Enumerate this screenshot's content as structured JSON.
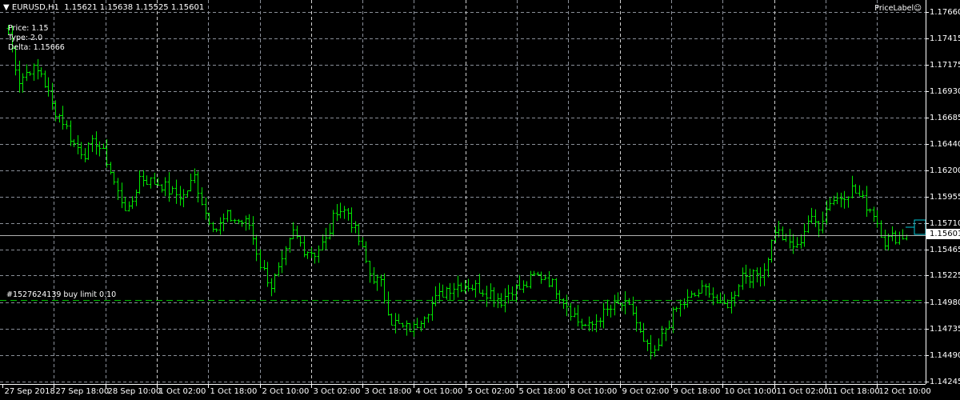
{
  "header": {
    "symbol": "EURUSD,H1",
    "ohlc": "1.15621 1.15638 1.15525 1.15601"
  },
  "info": {
    "price": "Price: 1.15",
    "type": "Type: 2.0",
    "delta": "Delta: 1.15666"
  },
  "indicator_label": "PriceLabel",
  "current_price": "1.15601",
  "order_label": "#1527624139 buy limit 0.10",
  "colors": {
    "bars": "#00e600",
    "grid": "#8a8f99",
    "order_line": "#00c000",
    "price_box": "#00c8d8"
  },
  "chart_data": {
    "type": "ohlc",
    "symbol": "EURUSD",
    "timeframe": "H1",
    "ylim": [
      1.14245,
      1.1766
    ],
    "y_ticks": [
      "1.17660",
      "1.17415",
      "1.17175",
      "1.16930",
      "1.16685",
      "1.16440",
      "1.16200",
      "1.15955",
      "1.15710",
      "1.15465",
      "1.15225",
      "1.14980",
      "1.14735",
      "1.14490",
      "1.14245"
    ],
    "x_ticks": [
      "27 Sep 2018",
      "27 Sep 18:00",
      "28 Sep 10:00",
      "1 Oct 02:00",
      "1 Oct 18:00",
      "2 Oct 10:00",
      "3 Oct 02:00",
      "3 Oct 18:00",
      "4 Oct 10:00",
      "5 Oct 02:00",
      "5 Oct 18:00",
      "8 Oct 10:00",
      "9 Oct 02:00",
      "9 Oct 18:00",
      "10 Oct 10:00",
      "11 Oct 02:00",
      "11 Oct 18:00",
      "12 Oct 10:00"
    ],
    "close_path": [
      1.1747,
      1.1703,
      1.1714,
      1.171,
      1.168,
      1.1666,
      1.1644,
      1.1636,
      1.1647,
      1.1629,
      1.1599,
      1.1581,
      1.1614,
      1.161,
      1.1607,
      1.1599,
      1.1596,
      1.1614,
      1.1581,
      1.1566,
      1.1577,
      1.1573,
      1.157,
      1.1533,
      1.1514,
      1.1533,
      1.1562,
      1.1548,
      1.1544,
      1.1555,
      1.1585,
      1.1581,
      1.1555,
      1.1525,
      1.1514,
      1.1481,
      1.1474,
      1.1474,
      1.1489,
      1.15,
      1.1511,
      1.1514,
      1.1514,
      1.1511,
      1.1507,
      1.15,
      1.1511,
      1.1511,
      1.1522,
      1.1522,
      1.1511,
      1.1496,
      1.1481,
      1.1474,
      1.1485,
      1.1492,
      1.1496,
      1.1489,
      1.1459,
      1.1448,
      1.1474,
      1.1492,
      1.15,
      1.1507,
      1.1511,
      1.1492,
      1.15,
      1.1525,
      1.1522,
      1.1529,
      1.1566,
      1.1555,
      1.1548,
      1.1574,
      1.157,
      1.1592,
      1.1596,
      1.1603,
      1.1592,
      1.1581,
      1.1555,
      1.1559,
      1.156
    ],
    "current_price": 1.15601,
    "buy_limit_price": 1.15
  }
}
